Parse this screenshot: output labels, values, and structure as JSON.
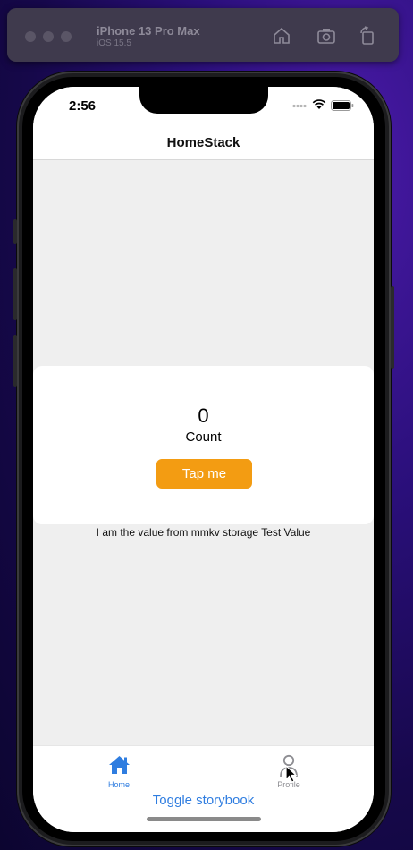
{
  "simulator": {
    "device": "iPhone 13 Pro Max",
    "os": "iOS 15.5",
    "toolbar_icons": [
      "home-icon",
      "screenshot-icon",
      "rotate-icon"
    ]
  },
  "status_bar": {
    "time": "2:56"
  },
  "header": {
    "title": "HomeStack"
  },
  "counter": {
    "value": "0",
    "label": "Count",
    "button_label": "Tap me",
    "button_color": "#f39c12"
  },
  "storage_message": "I am the value from mmkv storage Test Value",
  "tabs": [
    {
      "label": "Home",
      "icon": "home-icon",
      "active": true,
      "color": "#2f7de0"
    },
    {
      "label": "Profile",
      "icon": "person-icon",
      "active": false,
      "color": "#8e8e93"
    }
  ],
  "toggle_storybook": "Toggle storybook"
}
